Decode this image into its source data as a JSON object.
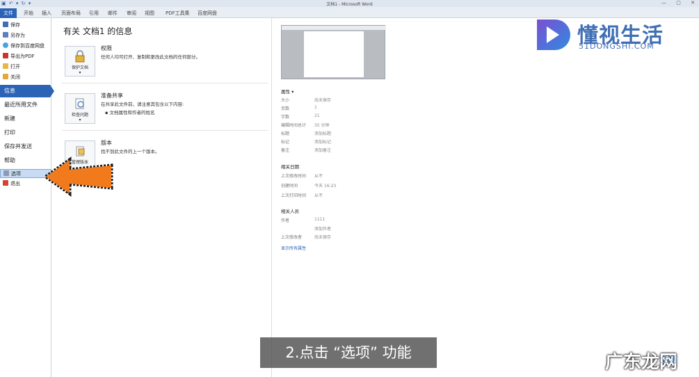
{
  "window": {
    "title": "文档1 - Microsoft Word",
    "quick_access": "▣ ↶ ▾ ↻ ▾",
    "controls": [
      "—",
      "▢",
      "✕"
    ]
  },
  "ribbon": {
    "file_tab": "文件",
    "tabs": [
      "开始",
      "插入",
      "页面布局",
      "引用",
      "邮件",
      "审阅",
      "视图",
      "PDF工具集",
      "百度网盘"
    ]
  },
  "sidebar": {
    "small_items": [
      {
        "label": "保存",
        "icon": "save-icon"
      },
      {
        "label": "另存为",
        "icon": "save-as-icon"
      },
      {
        "label": "保存到百度网盘",
        "icon": "cloud-save-icon"
      },
      {
        "label": "导出为PDF",
        "icon": "pdf-icon"
      },
      {
        "label": "打开",
        "icon": "open-folder-icon"
      },
      {
        "label": "关闭",
        "icon": "close-doc-icon"
      }
    ],
    "info": "信息",
    "recent": "最近所用文件",
    "new": "新建",
    "print": "打印",
    "save_send": "保存并发送",
    "help": "帮助",
    "options": "选项",
    "exit": "退出"
  },
  "main": {
    "heading": "有关 文档1 的信息",
    "permissions": {
      "button": "保护文档",
      "title": "权限",
      "desc": "任何人均可打开、复制和更改此文档的任何部分。"
    },
    "share": {
      "button": "检查问题",
      "title": "准备共享",
      "desc": "在共享此文件前，请注意其包含以下内容:",
      "bullet": "文档属性和作者的姓名"
    },
    "versions": {
      "button": "管理版本",
      "title": "版本",
      "desc": "找不到此文件的上一个版本。"
    }
  },
  "properties": {
    "header": "属性 ▾",
    "rows": [
      {
        "k": "大小",
        "v": "尚未保存"
      },
      {
        "k": "页数",
        "v": "1"
      },
      {
        "k": "字数",
        "v": "21"
      },
      {
        "k": "编辑时间总计",
        "v": "35 分钟"
      },
      {
        "k": "标题",
        "v": "添加标题"
      },
      {
        "k": "标记",
        "v": "添加标记"
      },
      {
        "k": "备注",
        "v": "添加备注"
      }
    ],
    "dates_header": "相关日期",
    "dates": [
      {
        "k": "上次修改时间",
        "v": "从不"
      },
      {
        "k": "创建时间",
        "v": "今天 16:23"
      },
      {
        "k": "上次打印时间",
        "v": "从不"
      }
    ],
    "people_header": "相关人员",
    "people": [
      {
        "k": "作者",
        "v": "1111"
      },
      {
        "k": "",
        "v": "添加作者"
      },
      {
        "k": "上次修改者",
        "v": "尚未保存"
      }
    ],
    "show_all": "显示所有属性"
  },
  "logo": {
    "cn": "懂视生活",
    "en": "51DONGSHI.COM"
  },
  "caption": "2.点击 “选项” 功能",
  "watermark": "广东龙网",
  "watermark2": "生活",
  "colors": {
    "accent": "#2b63b7",
    "arrow": "#f07a1c"
  }
}
